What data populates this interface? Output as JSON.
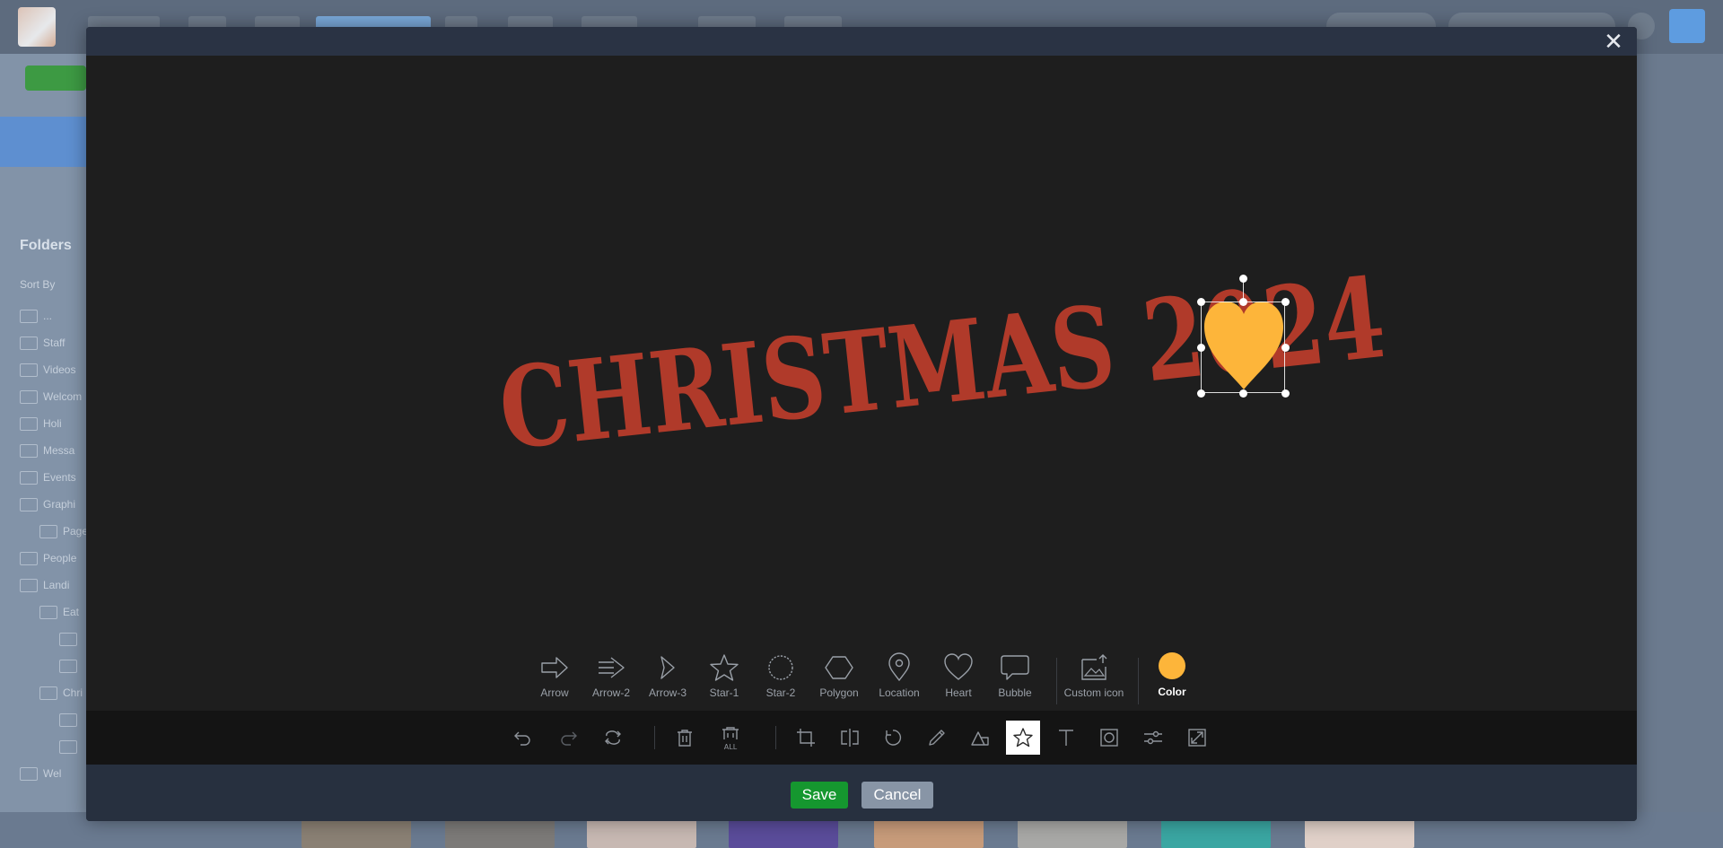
{
  "modal": {
    "close_glyph": "✕"
  },
  "canvas": {
    "text_object": "CHRISTMAS 2024",
    "text_color": "#b03a2a",
    "shape_object": "heart",
    "shape_color": "#fdb53a"
  },
  "shapes": [
    {
      "label": "Arrow",
      "icon": "arrow-icon"
    },
    {
      "label": "Arrow-2",
      "icon": "arrow-2-icon"
    },
    {
      "label": "Arrow-3",
      "icon": "arrow-3-icon"
    },
    {
      "label": "Star-1",
      "icon": "star-1-icon"
    },
    {
      "label": "Star-2",
      "icon": "star-2-icon"
    },
    {
      "label": "Polygon",
      "icon": "polygon-icon"
    },
    {
      "label": "Location",
      "icon": "location-icon"
    },
    {
      "label": "Heart",
      "icon": "heart-icon"
    },
    {
      "label": "Bubble",
      "icon": "bubble-icon"
    }
  ],
  "custom_icon": {
    "label": "Custom icon",
    "icon": "custom-icon-upload-icon"
  },
  "color_picker": {
    "label": "Color",
    "value": "#fdb53a"
  },
  "toolbar": {
    "tools": [
      "undo",
      "redo",
      "reset",
      "delete",
      "delete-all",
      "crop",
      "flip",
      "rotate",
      "draw",
      "shape",
      "icon",
      "text",
      "mask",
      "filter",
      "resize"
    ],
    "active": "icon",
    "delete_all_label": "ALL"
  },
  "footer": {
    "save_label": "Save",
    "cancel_label": "Cancel"
  },
  "background": {
    "folders_title": "Folders",
    "sort_by": "Sort By",
    "folder_items": [
      "...",
      "Staff",
      "Videos",
      "Welcom",
      "Holi",
      "Messa",
      "Events",
      "Graphi",
      "Page",
      "People",
      "Landi",
      "Eat",
      "",
      "",
      "Chri",
      "",
      "",
      "Wel"
    ]
  }
}
